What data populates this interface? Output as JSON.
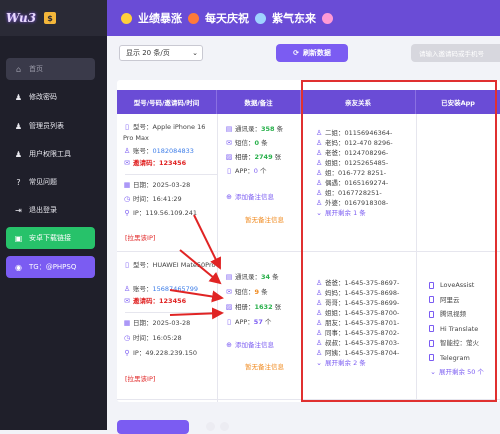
{
  "brand": {
    "logo_text": "Wu3",
    "badge_icon": "money-bag-icon"
  },
  "banner": {
    "part1": "业绩暴涨",
    "part2": "每天庆祝",
    "part3": "紫气东来"
  },
  "sidebar": {
    "items": [
      {
        "label": "首页",
        "icon": "home-icon"
      },
      {
        "label": "修改密码",
        "icon": "user-key-icon"
      },
      {
        "label": "管理员列表",
        "icon": "user-list-icon"
      },
      {
        "label": "用户权限工具",
        "icon": "user-lock-icon"
      },
      {
        "label": "常见问题",
        "icon": "question-icon"
      },
      {
        "label": "退出登录",
        "icon": "logout-icon"
      },
      {
        "label": "安卓下载链接",
        "icon": "android-icon"
      },
      {
        "label": "TG：@PHPSQ",
        "icon": "telegram-icon"
      }
    ]
  },
  "toolbar": {
    "page_size": "显示 20 条/页",
    "refresh_label": "刷新数据",
    "search_placeholder": "请输入邀请码或手机号"
  },
  "table": {
    "headers": [
      "型号/号码/邀请码/时间",
      "数据/备注",
      "亲友关系",
      "已安装App"
    ],
    "rows": [
      {
        "model_label": "型号：",
        "model": "Apple iPhone 16 Pro Max",
        "account_label": "账号：",
        "account": "0182084833",
        "invite_label": "邀请码：",
        "invite": "123456",
        "date": "日期：2025-03-28",
        "time": "时间：16:41:29",
        "ip": "IP：119.56.109.241",
        "block_link": "[拉黑该IP]",
        "contacts": "358",
        "sms": "0",
        "photos": "2749",
        "apps": "0",
        "contacts_label": "通讯录：",
        "sms_label": "短信：",
        "photos_label": "相册：",
        "apps_label": "APP：",
        "unit_tiao": "条",
        "unit_zhang": "张",
        "unit_ge": "个",
        "add_note": "添加备注信息",
        "no_note": "暂无备注信息",
        "relations": [
          "二姐：01156946364-",
          "老妈：012-470 8296-",
          "老爸：0124708296-",
          "姐姐：0125265485-",
          "姐：016-772 8251-",
          "偶遇：0165169274-",
          "姐：0167728251-",
          "外婆：0167918308-"
        ],
        "relations_more": "展开剩余 1 条",
        "installed": [],
        "installed_more": ""
      },
      {
        "model_label": "型号：",
        "model": "HUAWEI Mate50Pro",
        "account_label": "账号：",
        "account": "15687465799",
        "invite_label": "邀请码：",
        "invite": "123456",
        "date": "日期：2025-03-28",
        "time": "时间：16:05:28",
        "ip": "IP：49.228.239.150",
        "block_link": "[拉黑该IP]",
        "contacts": "34",
        "sms": "9",
        "photos": "1632",
        "apps": "57",
        "contacts_label": "通讯录：",
        "sms_label": "短信：",
        "photos_label": "相册：",
        "apps_label": "APP：",
        "unit_tiao": "条",
        "unit_zhang": "张",
        "unit_ge": "个",
        "add_note": "添加备注信息",
        "no_note": "暂无备注信息",
        "relations": [
          "爸爸：1-645-375-8697-",
          "妈妈：1-645-375-8698-",
          "哥哥：1-645-375-8699-",
          "姐姐：1-645-375-8700-",
          "朋友：1-645-375-8701-",
          "同事：1-645-375-8702-",
          "叔叔：1-645-375-8703-",
          "阿姨：1-645-375-8704-"
        ],
        "relations_more": "展开剩余 2 条",
        "installed": [
          "LoveAssist",
          "阿里云",
          "腾讯视频",
          "Hi Translate",
          "智能控：萤火",
          "Telegram"
        ],
        "installed_more": "展开剩余 50 个"
      }
    ]
  },
  "colors": {
    "accent": "#6a4cd6",
    "sidebar": "#1f1f2a",
    "highlight": "#e03030"
  }
}
